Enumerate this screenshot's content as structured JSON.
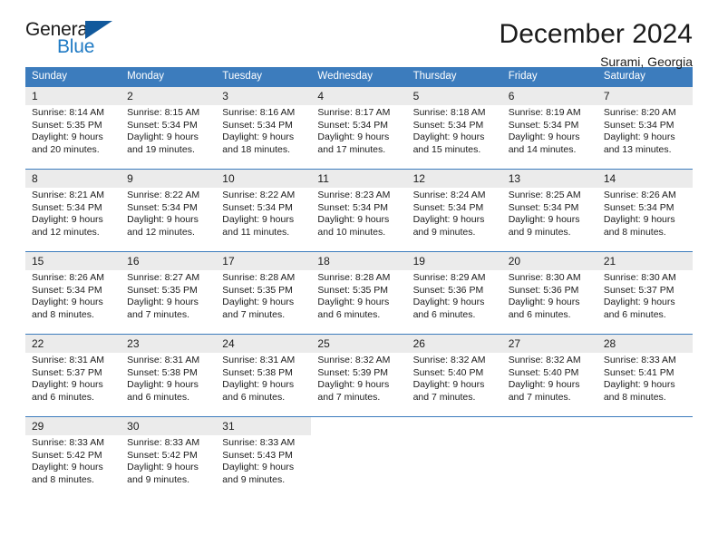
{
  "brand": {
    "word_one": "General",
    "word_two": "Blue",
    "triangle_icon": "blue-triangle-logo-mark"
  },
  "header": {
    "title": "December 2024",
    "subtitle": "Surami, Georgia"
  },
  "colors": {
    "header_blue": "#3c7cbd",
    "brand_blue": "#1f7ac4",
    "brand_triangle": "#11599c",
    "daynum_band": "#ebebeb",
    "text": "#1b1b1b"
  },
  "calendar": {
    "weekday_headers": [
      "Sunday",
      "Monday",
      "Tuesday",
      "Wednesday",
      "Thursday",
      "Friday",
      "Saturday"
    ],
    "weeks": [
      [
        {
          "day": "1",
          "lines": [
            "Sunrise: 8:14 AM",
            "Sunset: 5:35 PM",
            "Daylight: 9 hours",
            "and 20 minutes."
          ]
        },
        {
          "day": "2",
          "lines": [
            "Sunrise: 8:15 AM",
            "Sunset: 5:34 PM",
            "Daylight: 9 hours",
            "and 19 minutes."
          ]
        },
        {
          "day": "3",
          "lines": [
            "Sunrise: 8:16 AM",
            "Sunset: 5:34 PM",
            "Daylight: 9 hours",
            "and 18 minutes."
          ]
        },
        {
          "day": "4",
          "lines": [
            "Sunrise: 8:17 AM",
            "Sunset: 5:34 PM",
            "Daylight: 9 hours",
            "and 17 minutes."
          ]
        },
        {
          "day": "5",
          "lines": [
            "Sunrise: 8:18 AM",
            "Sunset: 5:34 PM",
            "Daylight: 9 hours",
            "and 15 minutes."
          ]
        },
        {
          "day": "6",
          "lines": [
            "Sunrise: 8:19 AM",
            "Sunset: 5:34 PM",
            "Daylight: 9 hours",
            "and 14 minutes."
          ]
        },
        {
          "day": "7",
          "lines": [
            "Sunrise: 8:20 AM",
            "Sunset: 5:34 PM",
            "Daylight: 9 hours",
            "and 13 minutes."
          ]
        }
      ],
      [
        {
          "day": "8",
          "lines": [
            "Sunrise: 8:21 AM",
            "Sunset: 5:34 PM",
            "Daylight: 9 hours",
            "and 12 minutes."
          ]
        },
        {
          "day": "9",
          "lines": [
            "Sunrise: 8:22 AM",
            "Sunset: 5:34 PM",
            "Daylight: 9 hours",
            "and 12 minutes."
          ]
        },
        {
          "day": "10",
          "lines": [
            "Sunrise: 8:22 AM",
            "Sunset: 5:34 PM",
            "Daylight: 9 hours",
            "and 11 minutes."
          ]
        },
        {
          "day": "11",
          "lines": [
            "Sunrise: 8:23 AM",
            "Sunset: 5:34 PM",
            "Daylight: 9 hours",
            "and 10 minutes."
          ]
        },
        {
          "day": "12",
          "lines": [
            "Sunrise: 8:24 AM",
            "Sunset: 5:34 PM",
            "Daylight: 9 hours",
            "and 9 minutes."
          ]
        },
        {
          "day": "13",
          "lines": [
            "Sunrise: 8:25 AM",
            "Sunset: 5:34 PM",
            "Daylight: 9 hours",
            "and 9 minutes."
          ]
        },
        {
          "day": "14",
          "lines": [
            "Sunrise: 8:26 AM",
            "Sunset: 5:34 PM",
            "Daylight: 9 hours",
            "and 8 minutes."
          ]
        }
      ],
      [
        {
          "day": "15",
          "lines": [
            "Sunrise: 8:26 AM",
            "Sunset: 5:34 PM",
            "Daylight: 9 hours",
            "and 8 minutes."
          ]
        },
        {
          "day": "16",
          "lines": [
            "Sunrise: 8:27 AM",
            "Sunset: 5:35 PM",
            "Daylight: 9 hours",
            "and 7 minutes."
          ]
        },
        {
          "day": "17",
          "lines": [
            "Sunrise: 8:28 AM",
            "Sunset: 5:35 PM",
            "Daylight: 9 hours",
            "and 7 minutes."
          ]
        },
        {
          "day": "18",
          "lines": [
            "Sunrise: 8:28 AM",
            "Sunset: 5:35 PM",
            "Daylight: 9 hours",
            "and 6 minutes."
          ]
        },
        {
          "day": "19",
          "lines": [
            "Sunrise: 8:29 AM",
            "Sunset: 5:36 PM",
            "Daylight: 9 hours",
            "and 6 minutes."
          ]
        },
        {
          "day": "20",
          "lines": [
            "Sunrise: 8:30 AM",
            "Sunset: 5:36 PM",
            "Daylight: 9 hours",
            "and 6 minutes."
          ]
        },
        {
          "day": "21",
          "lines": [
            "Sunrise: 8:30 AM",
            "Sunset: 5:37 PM",
            "Daylight: 9 hours",
            "and 6 minutes."
          ]
        }
      ],
      [
        {
          "day": "22",
          "lines": [
            "Sunrise: 8:31 AM",
            "Sunset: 5:37 PM",
            "Daylight: 9 hours",
            "and 6 minutes."
          ]
        },
        {
          "day": "23",
          "lines": [
            "Sunrise: 8:31 AM",
            "Sunset: 5:38 PM",
            "Daylight: 9 hours",
            "and 6 minutes."
          ]
        },
        {
          "day": "24",
          "lines": [
            "Sunrise: 8:31 AM",
            "Sunset: 5:38 PM",
            "Daylight: 9 hours",
            "and 6 minutes."
          ]
        },
        {
          "day": "25",
          "lines": [
            "Sunrise: 8:32 AM",
            "Sunset: 5:39 PM",
            "Daylight: 9 hours",
            "and 7 minutes."
          ]
        },
        {
          "day": "26",
          "lines": [
            "Sunrise: 8:32 AM",
            "Sunset: 5:40 PM",
            "Daylight: 9 hours",
            "and 7 minutes."
          ]
        },
        {
          "day": "27",
          "lines": [
            "Sunrise: 8:32 AM",
            "Sunset: 5:40 PM",
            "Daylight: 9 hours",
            "and 7 minutes."
          ]
        },
        {
          "day": "28",
          "lines": [
            "Sunrise: 8:33 AM",
            "Sunset: 5:41 PM",
            "Daylight: 9 hours",
            "and 8 minutes."
          ]
        }
      ],
      [
        {
          "day": "29",
          "lines": [
            "Sunrise: 8:33 AM",
            "Sunset: 5:42 PM",
            "Daylight: 9 hours",
            "and 8 minutes."
          ]
        },
        {
          "day": "30",
          "lines": [
            "Sunrise: 8:33 AM",
            "Sunset: 5:42 PM",
            "Daylight: 9 hours",
            "and 9 minutes."
          ]
        },
        {
          "day": "31",
          "lines": [
            "Sunrise: 8:33 AM",
            "Sunset: 5:43 PM",
            "Daylight: 9 hours",
            "and 9 minutes."
          ]
        },
        {
          "day": "",
          "lines": []
        },
        {
          "day": "",
          "lines": []
        },
        {
          "day": "",
          "lines": []
        },
        {
          "day": "",
          "lines": []
        }
      ]
    ]
  }
}
